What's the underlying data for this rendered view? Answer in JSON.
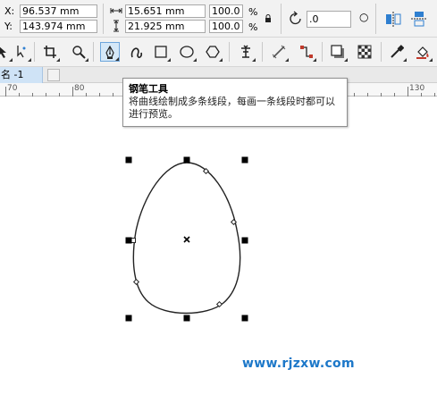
{
  "property_bar": {
    "x_label": "X:",
    "x_value": "96.537 mm",
    "y_label": "Y:",
    "y_value": "143.974 mm",
    "width_value": "15.651 mm",
    "height_value": "21.925 mm",
    "scale_x_value": "100.0",
    "scale_y_value": "100.0",
    "percent_symbol": "%",
    "rotation_value": ".0",
    "rotation_unit": "○"
  },
  "document": {
    "tab_label": "名 -1"
  },
  "ruler": {
    "labels": [
      "70",
      "80",
      "130"
    ]
  },
  "tooltip": {
    "title": "钢笔工具",
    "description": "将曲线绘制成多条线段，每画一条线段时都可以进行预览。"
  },
  "watermark": {
    "text": "www.rjzxw.com"
  },
  "colors": {
    "accent": "#1d78c9",
    "active_tool_bg": "#d5e8f8",
    "active_tool_border": "#6ea6dc"
  }
}
